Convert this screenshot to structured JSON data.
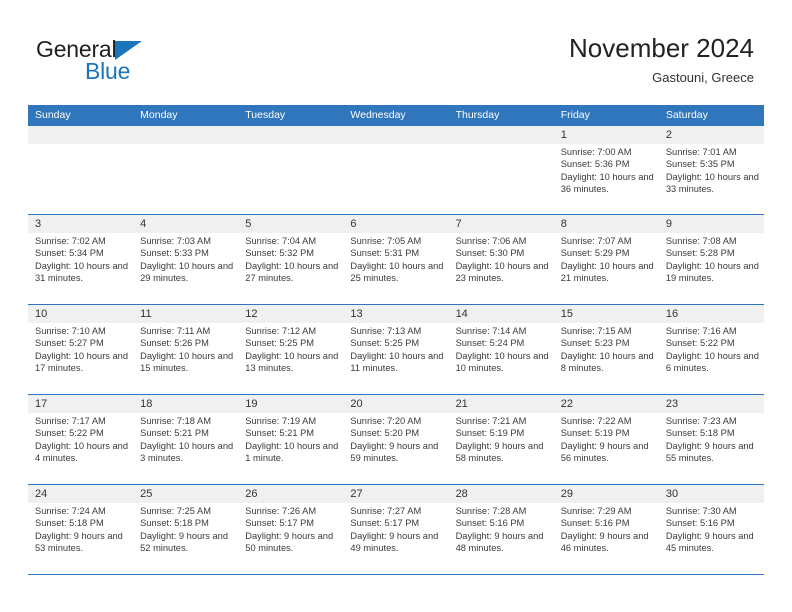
{
  "brand": {
    "name_part1": "General",
    "name_part2": "Blue"
  },
  "header": {
    "title": "November 2024",
    "subtitle": "Gastouni, Greece"
  },
  "colors": {
    "header_bar": "#3076bd",
    "brand_blue": "#1b75bb",
    "daynum_band": "#f0f0f0",
    "row_divider": "#3076bd"
  },
  "weekdays": [
    "Sunday",
    "Monday",
    "Tuesday",
    "Wednesday",
    "Thursday",
    "Friday",
    "Saturday"
  ],
  "weeks": [
    [
      {
        "day": "",
        "empty": true
      },
      {
        "day": "",
        "empty": true
      },
      {
        "day": "",
        "empty": true
      },
      {
        "day": "",
        "empty": true
      },
      {
        "day": "",
        "empty": true
      },
      {
        "day": "1",
        "sunrise": "Sunrise: 7:00 AM",
        "sunset": "Sunset: 5:36 PM",
        "daylight": "Daylight: 10 hours and 36 minutes."
      },
      {
        "day": "2",
        "sunrise": "Sunrise: 7:01 AM",
        "sunset": "Sunset: 5:35 PM",
        "daylight": "Daylight: 10 hours and 33 minutes."
      }
    ],
    [
      {
        "day": "3",
        "sunrise": "Sunrise: 7:02 AM",
        "sunset": "Sunset: 5:34 PM",
        "daylight": "Daylight: 10 hours and 31 minutes."
      },
      {
        "day": "4",
        "sunrise": "Sunrise: 7:03 AM",
        "sunset": "Sunset: 5:33 PM",
        "daylight": "Daylight: 10 hours and 29 minutes."
      },
      {
        "day": "5",
        "sunrise": "Sunrise: 7:04 AM",
        "sunset": "Sunset: 5:32 PM",
        "daylight": "Daylight: 10 hours and 27 minutes."
      },
      {
        "day": "6",
        "sunrise": "Sunrise: 7:05 AM",
        "sunset": "Sunset: 5:31 PM",
        "daylight": "Daylight: 10 hours and 25 minutes."
      },
      {
        "day": "7",
        "sunrise": "Sunrise: 7:06 AM",
        "sunset": "Sunset: 5:30 PM",
        "daylight": "Daylight: 10 hours and 23 minutes."
      },
      {
        "day": "8",
        "sunrise": "Sunrise: 7:07 AM",
        "sunset": "Sunset: 5:29 PM",
        "daylight": "Daylight: 10 hours and 21 minutes."
      },
      {
        "day": "9",
        "sunrise": "Sunrise: 7:08 AM",
        "sunset": "Sunset: 5:28 PM",
        "daylight": "Daylight: 10 hours and 19 minutes."
      }
    ],
    [
      {
        "day": "10",
        "sunrise": "Sunrise: 7:10 AM",
        "sunset": "Sunset: 5:27 PM",
        "daylight": "Daylight: 10 hours and 17 minutes."
      },
      {
        "day": "11",
        "sunrise": "Sunrise: 7:11 AM",
        "sunset": "Sunset: 5:26 PM",
        "daylight": "Daylight: 10 hours and 15 minutes."
      },
      {
        "day": "12",
        "sunrise": "Sunrise: 7:12 AM",
        "sunset": "Sunset: 5:25 PM",
        "daylight": "Daylight: 10 hours and 13 minutes."
      },
      {
        "day": "13",
        "sunrise": "Sunrise: 7:13 AM",
        "sunset": "Sunset: 5:25 PM",
        "daylight": "Daylight: 10 hours and 11 minutes."
      },
      {
        "day": "14",
        "sunrise": "Sunrise: 7:14 AM",
        "sunset": "Sunset: 5:24 PM",
        "daylight": "Daylight: 10 hours and 10 minutes."
      },
      {
        "day": "15",
        "sunrise": "Sunrise: 7:15 AM",
        "sunset": "Sunset: 5:23 PM",
        "daylight": "Daylight: 10 hours and 8 minutes."
      },
      {
        "day": "16",
        "sunrise": "Sunrise: 7:16 AM",
        "sunset": "Sunset: 5:22 PM",
        "daylight": "Daylight: 10 hours and 6 minutes."
      }
    ],
    [
      {
        "day": "17",
        "sunrise": "Sunrise: 7:17 AM",
        "sunset": "Sunset: 5:22 PM",
        "daylight": "Daylight: 10 hours and 4 minutes."
      },
      {
        "day": "18",
        "sunrise": "Sunrise: 7:18 AM",
        "sunset": "Sunset: 5:21 PM",
        "daylight": "Daylight: 10 hours and 3 minutes."
      },
      {
        "day": "19",
        "sunrise": "Sunrise: 7:19 AM",
        "sunset": "Sunset: 5:21 PM",
        "daylight": "Daylight: 10 hours and 1 minute."
      },
      {
        "day": "20",
        "sunrise": "Sunrise: 7:20 AM",
        "sunset": "Sunset: 5:20 PM",
        "daylight": "Daylight: 9 hours and 59 minutes."
      },
      {
        "day": "21",
        "sunrise": "Sunrise: 7:21 AM",
        "sunset": "Sunset: 5:19 PM",
        "daylight": "Daylight: 9 hours and 58 minutes."
      },
      {
        "day": "22",
        "sunrise": "Sunrise: 7:22 AM",
        "sunset": "Sunset: 5:19 PM",
        "daylight": "Daylight: 9 hours and 56 minutes."
      },
      {
        "day": "23",
        "sunrise": "Sunrise: 7:23 AM",
        "sunset": "Sunset: 5:18 PM",
        "daylight": "Daylight: 9 hours and 55 minutes."
      }
    ],
    [
      {
        "day": "24",
        "sunrise": "Sunrise: 7:24 AM",
        "sunset": "Sunset: 5:18 PM",
        "daylight": "Daylight: 9 hours and 53 minutes."
      },
      {
        "day": "25",
        "sunrise": "Sunrise: 7:25 AM",
        "sunset": "Sunset: 5:18 PM",
        "daylight": "Daylight: 9 hours and 52 minutes."
      },
      {
        "day": "26",
        "sunrise": "Sunrise: 7:26 AM",
        "sunset": "Sunset: 5:17 PM",
        "daylight": "Daylight: 9 hours and 50 minutes."
      },
      {
        "day": "27",
        "sunrise": "Sunrise: 7:27 AM",
        "sunset": "Sunset: 5:17 PM",
        "daylight": "Daylight: 9 hours and 49 minutes."
      },
      {
        "day": "28",
        "sunrise": "Sunrise: 7:28 AM",
        "sunset": "Sunset: 5:16 PM",
        "daylight": "Daylight: 9 hours and 48 minutes."
      },
      {
        "day": "29",
        "sunrise": "Sunrise: 7:29 AM",
        "sunset": "Sunset: 5:16 PM",
        "daylight": "Daylight: 9 hours and 46 minutes."
      },
      {
        "day": "30",
        "sunrise": "Sunrise: 7:30 AM",
        "sunset": "Sunset: 5:16 PM",
        "daylight": "Daylight: 9 hours and 45 minutes."
      }
    ]
  ]
}
